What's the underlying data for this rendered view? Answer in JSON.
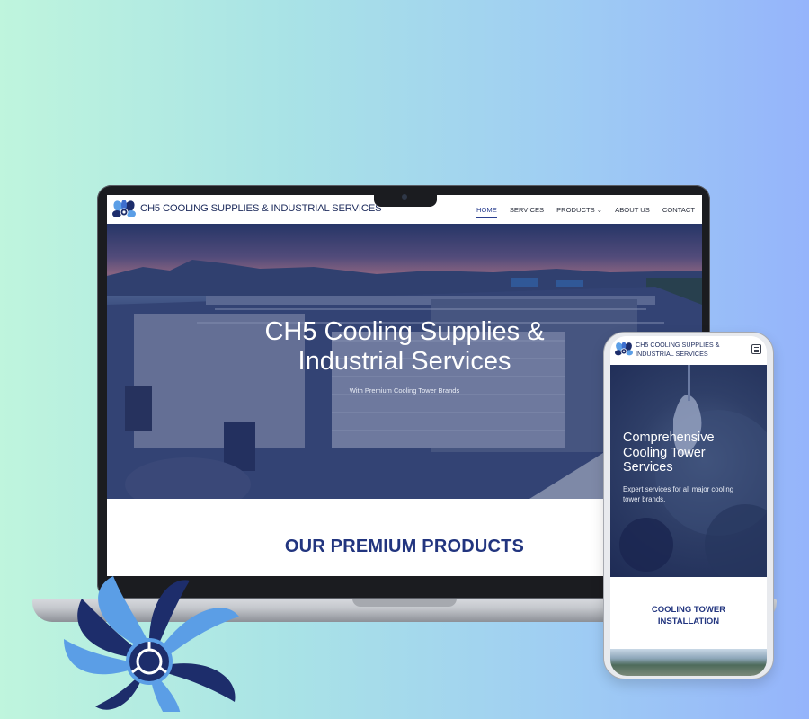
{
  "desktop": {
    "brand": "CH5 COOLING SUPPLIES & INDUSTRIAL SERVICES",
    "nav": [
      {
        "label": "HOME",
        "active": true
      },
      {
        "label": "SERVICES"
      },
      {
        "label": "PRODUCTS ⌄"
      },
      {
        "label": "ABOUT US"
      },
      {
        "label": "CONTACT"
      }
    ],
    "hero": {
      "title_line1": "CH5 Cooling Supplies &",
      "title_line2": "Industrial Services",
      "subtitle": "With Premium Cooling Tower Brands"
    },
    "section_title": "OUR PREMIUM PRODUCTS"
  },
  "mobile": {
    "brand_line1": "CH5 COOLING SUPPLIES &",
    "brand_line2": "INDUSTRIAL SERVICES",
    "hero": {
      "title_line1": "Comprehensive",
      "title_line2": "Cooling Tower",
      "title_line3": "Services",
      "text_line1": "Expert services for all major cooling",
      "text_line2": "tower brands."
    },
    "section_line1": "COOLING TOWER",
    "section_line2": "INSTALLATION"
  },
  "colors": {
    "brand_blue": "#22357f",
    "fan_light": "#5b9ee6",
    "fan_dark": "#1d2d6b"
  },
  "icons": {
    "logo": "fan-logo-icon",
    "menu": "hamburger-menu-icon"
  }
}
